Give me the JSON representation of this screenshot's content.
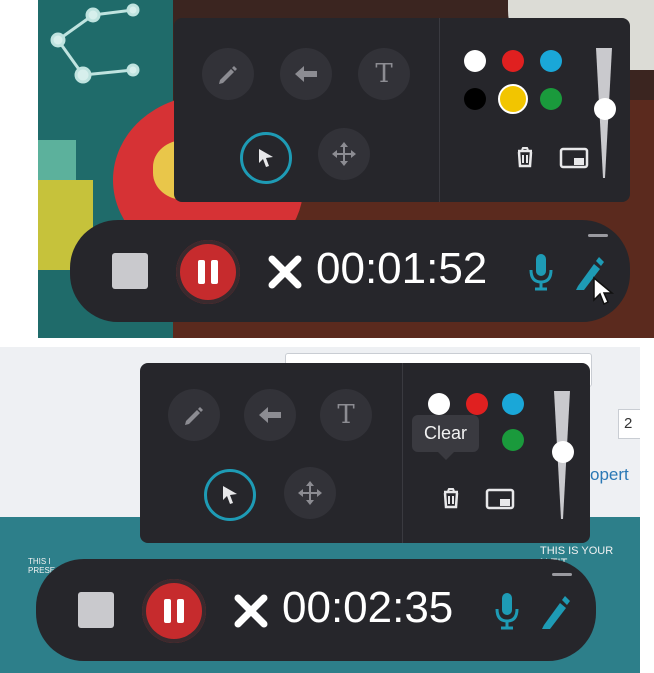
{
  "colors": {
    "accent": "#1e9bb5",
    "toolbar_bg": "#26262b",
    "record_red": "#c62b2d",
    "tooltip_bg": "#3a3a40"
  },
  "tools": [
    {
      "name": "pen",
      "icon": "pencil-icon"
    },
    {
      "name": "arrow",
      "icon": "arrow-left-icon"
    },
    {
      "name": "text",
      "icon": "text-icon",
      "label": "T"
    },
    {
      "name": "select",
      "icon": "cursor-icon",
      "active": true
    },
    {
      "name": "move",
      "icon": "move-icon"
    }
  ],
  "palette": [
    "#ffffff",
    "#e02020",
    "#1aa7d8",
    "#000000",
    "#f2c500",
    "#1a9a3c"
  ],
  "selected_color": "#f2c500",
  "actions": [
    {
      "name": "clear",
      "icon": "trash-icon"
    },
    {
      "name": "screen",
      "icon": "screen-icon"
    }
  ],
  "brush_size_slider": 0.35,
  "screenshot_top": {
    "timer": "00:01:52"
  },
  "screenshot_bottom": {
    "timer": "00:02:35",
    "tooltip": "Clear",
    "background": {
      "field_value": "2",
      "link_text": "opert",
      "slide_text_left": "THIS I\nPRESE",
      "slide_text_right": "THIS IS YOUR\nN TIT"
    }
  }
}
